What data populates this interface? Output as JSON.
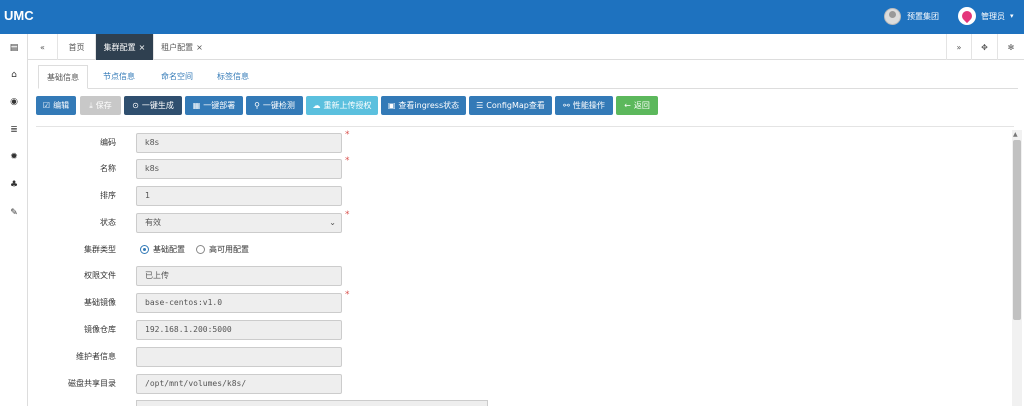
{
  "header": {
    "logo": "UMC",
    "org_name": "预置集团",
    "user_name": "管理员",
    "caret": "▾"
  },
  "leftnav": {
    "items": [
      {
        "icon": "id-card-icon",
        "glyph": "▤"
      },
      {
        "icon": "bank-icon",
        "glyph": "⌂"
      },
      {
        "icon": "eye-icon",
        "glyph": "◉"
      },
      {
        "icon": "list-icon",
        "glyph": "≣"
      },
      {
        "icon": "gear-icon",
        "glyph": "✹"
      },
      {
        "icon": "sitemap-icon",
        "glyph": "♣"
      },
      {
        "icon": "wrench-icon",
        "glyph": "✎"
      }
    ]
  },
  "tabbar": {
    "back": "«",
    "tabs": [
      {
        "label": "首页",
        "active": false,
        "closable": false
      },
      {
        "label": "集群配置",
        "active": true,
        "closable": true
      },
      {
        "label": "租户配置",
        "active": false,
        "closable": true
      }
    ],
    "close_glyph": "×",
    "forward": "»",
    "fullscreen": "✥",
    "settings": "✻"
  },
  "subtabs": [
    "基础信息",
    "节点信息",
    "命名空间",
    "标签信息"
  ],
  "toolbar": [
    {
      "icon": "edit-icon",
      "glyph": "☑",
      "label": "编辑",
      "style": "primary"
    },
    {
      "icon": "download-icon",
      "glyph": "⤓",
      "label": "保存",
      "style": "disabled"
    },
    {
      "icon": "generate-icon",
      "glyph": "⊙",
      "label": "一键生成",
      "style": "dark"
    },
    {
      "icon": "grid-icon",
      "glyph": "▦",
      "label": "一键部署",
      "style": "primary"
    },
    {
      "icon": "search-icon",
      "glyph": "⚲",
      "label": "一键检测",
      "style": "primary"
    },
    {
      "icon": "cloud-upload-icon",
      "glyph": "☁",
      "label": "重新上传授权",
      "style": "info"
    },
    {
      "icon": "doc-icon",
      "glyph": "▣",
      "label": "查看ingress状态",
      "style": "primary"
    },
    {
      "icon": "table-icon",
      "glyph": "☰",
      "label": "ConfigMap查看",
      "style": "primary"
    },
    {
      "icon": "link-icon",
      "glyph": "⚯",
      "label": "性能操作",
      "style": "primary"
    },
    {
      "icon": "arrow-left-icon",
      "glyph": "←",
      "label": "返回",
      "style": "success"
    }
  ],
  "form": {
    "code": {
      "label": "编码",
      "value": "k8s"
    },
    "name": {
      "label": "名称",
      "value": "k8s"
    },
    "sort": {
      "label": "排序",
      "value": "1"
    },
    "status": {
      "label": "状态",
      "value": "有效",
      "arrow": "⌄"
    },
    "cluster_type": {
      "label": "集群类型",
      "options": [
        "基础配置",
        "高可用配置"
      ],
      "selected": "基础配置"
    },
    "license_file": {
      "label": "权限文件",
      "value": "已上传"
    },
    "base_image": {
      "label": "基础镜像",
      "value": "base-centos:v1.0"
    },
    "registry": {
      "label": "镜像仓库",
      "value": "192.168.1.200:5000"
    },
    "maintainer": {
      "label": "维护者信息",
      "value": ""
    },
    "disk_share": {
      "label": "磁盘共享目录",
      "value": "/opt/mnt/volumes/k8s/"
    },
    "required_mark": "*"
  },
  "scroll_up": "▲"
}
